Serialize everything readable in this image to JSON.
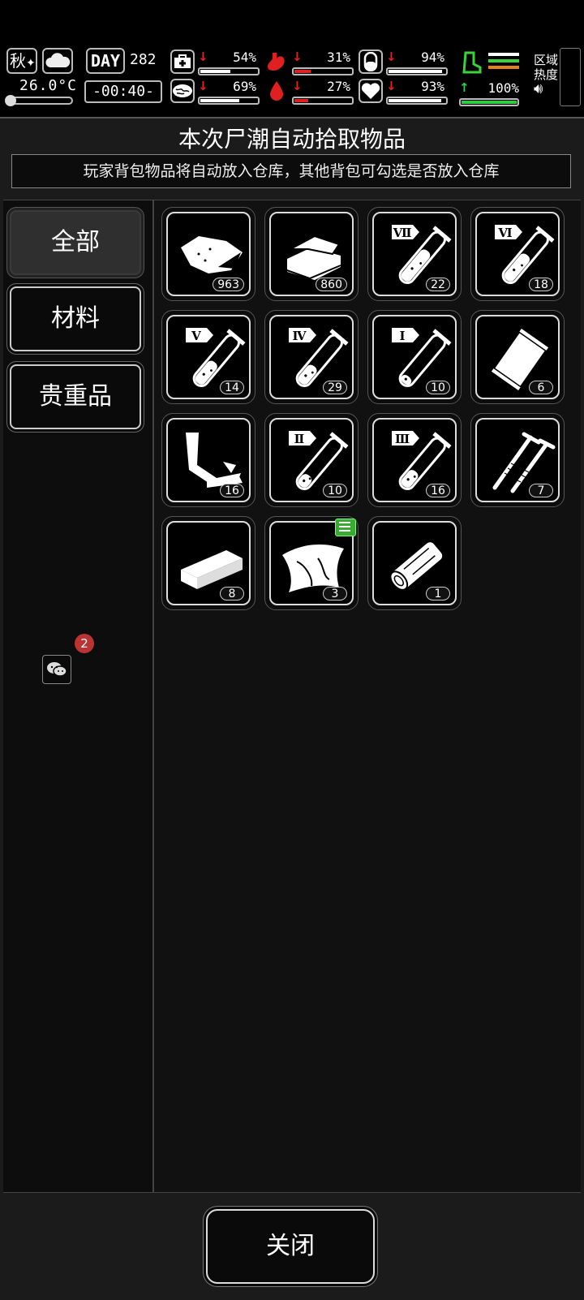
{
  "hud": {
    "season": "秋",
    "temperature": "26.0°C",
    "day_label": "DAY",
    "day_value": "282",
    "clock": "-00:40-",
    "stats": [
      {
        "name": "medical",
        "percent": "54%",
        "value": 0.54,
        "trend": "down",
        "color": "#ffffff"
      },
      {
        "name": "stomach",
        "percent": "31%",
        "value": 0.31,
        "trend": "down",
        "color": "#e02020"
      },
      {
        "name": "pill",
        "percent": "94%",
        "value": 0.94,
        "trend": "down",
        "color": "#ffffff"
      },
      {
        "name": "brain",
        "percent": "69%",
        "value": 0.69,
        "trend": "down",
        "color": "#ffffff"
      },
      {
        "name": "blood",
        "percent": "27%",
        "value": 0.27,
        "trend": "down",
        "color": "#e02020"
      },
      {
        "name": "heart",
        "percent": "93%",
        "value": 0.93,
        "trend": "down",
        "color": "#ffffff"
      }
    ],
    "stamina": {
      "percent": "100%",
      "value": 1.0,
      "trend": "up"
    },
    "area_heat_line1": "区域",
    "area_heat_line2": "热度"
  },
  "panel": {
    "title": "本次尸潮自动拾取物品",
    "notice": "玩家背包物品将自动放入仓库，其他背包可勾选是否放入仓库"
  },
  "categories": [
    {
      "label": "全部",
      "active": true
    },
    {
      "label": "材料",
      "active": false
    },
    {
      "label": "贵重品",
      "active": false
    }
  ],
  "notification_badge": "2",
  "items": [
    {
      "icon": "raw-meat-icon",
      "count": "963"
    },
    {
      "icon": "cloth-icon",
      "count": "860"
    },
    {
      "icon": "test-tube-icon",
      "numeral": "Ⅶ",
      "fill": 0.7,
      "count": "22"
    },
    {
      "icon": "test-tube-icon",
      "numeral": "Ⅵ",
      "fill": 0.6,
      "count": "18"
    },
    {
      "icon": "test-tube-icon",
      "numeral": "Ⅴ",
      "fill": 0.5,
      "count": "14"
    },
    {
      "icon": "test-tube-icon",
      "numeral": "Ⅳ",
      "fill": 0.4,
      "count": "29"
    },
    {
      "icon": "test-tube-icon",
      "numeral": "Ⅰ",
      "fill": 0.15,
      "count": "10"
    },
    {
      "icon": "plastic-bag-icon",
      "count": "6"
    },
    {
      "icon": "scrap-metal-icon",
      "count": "16"
    },
    {
      "icon": "test-tube-icon",
      "numeral": "Ⅱ",
      "fill": 0.25,
      "count": "10"
    },
    {
      "icon": "test-tube-icon",
      "numeral": "Ⅲ",
      "fill": 0.35,
      "count": "16"
    },
    {
      "icon": "nails-icon",
      "count": "7"
    },
    {
      "icon": "wood-plank-icon",
      "count": "8"
    },
    {
      "icon": "cloth-scrap-icon",
      "count": "3",
      "tagged": true
    },
    {
      "icon": "log-icon",
      "count": "1"
    }
  ],
  "close_label": "关闭"
}
